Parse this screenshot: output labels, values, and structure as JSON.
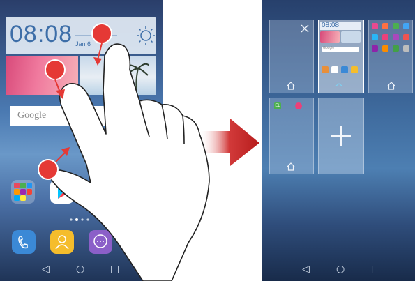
{
  "left_screen": {
    "clock": {
      "time": "08:08",
      "date": "Jan 6"
    },
    "search": {
      "brand": "Google"
    },
    "page_dots_count": 4,
    "active_page_dot": 2
  },
  "right_screen": {
    "mini_clock": "08:08",
    "mini_search": "Google",
    "mini_badge_left": "EL"
  },
  "nav": {
    "back": "◁",
    "home": "○",
    "recent": "□"
  },
  "colors": {
    "arrow_red": "#c62828",
    "marker_red": "#e53935",
    "clock_blue": "#3d6ea8"
  },
  "icons": [
    "sun-icon",
    "palm-tree-icon",
    "phone-icon",
    "contacts-icon",
    "message-icon",
    "play-store-icon",
    "home-icon",
    "close-icon",
    "plus-icon"
  ]
}
